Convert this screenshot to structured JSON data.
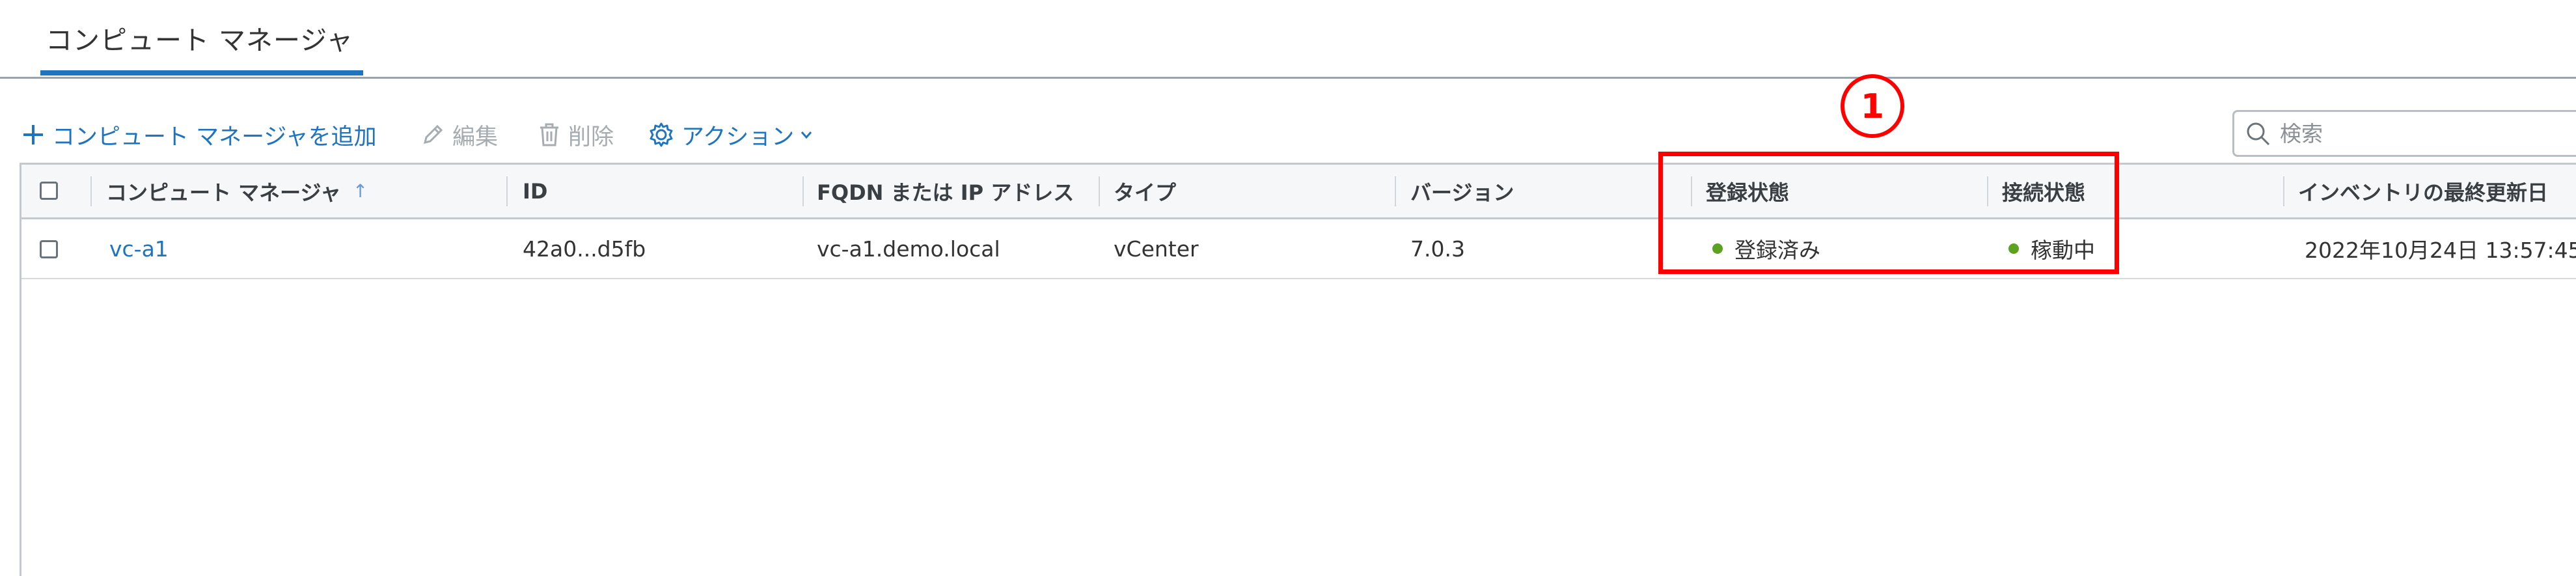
{
  "tabs": {
    "active": "コンピュート マネージャ"
  },
  "toolbar": {
    "add_label": "コンピュート マネージャを追加",
    "edit_label": "編集",
    "delete_label": "削除",
    "actions_label": "アクション"
  },
  "search": {
    "placeholder": "検索"
  },
  "table": {
    "columns": [
      "コンピュート マネージャ",
      "ID",
      "FQDN または IP アドレス",
      "タイプ",
      "バージョン",
      "登録状態",
      "接続状態",
      "インベントリの最終更新日"
    ],
    "rows": [
      {
        "name": "vc-a1",
        "id": "42a0...d5fb",
        "fqdn": "vc-a1.demo.local",
        "type": "vCenter",
        "version": "7.0.3",
        "registration": "登録済み",
        "connection": "稼動中",
        "last_updated": "2022年10月24日 13:57:45"
      }
    ]
  },
  "annotation": {
    "label": "1"
  },
  "colors": {
    "accent": "#1f74c0",
    "status_ok": "#5aa220",
    "annotation": "#ff0000"
  }
}
